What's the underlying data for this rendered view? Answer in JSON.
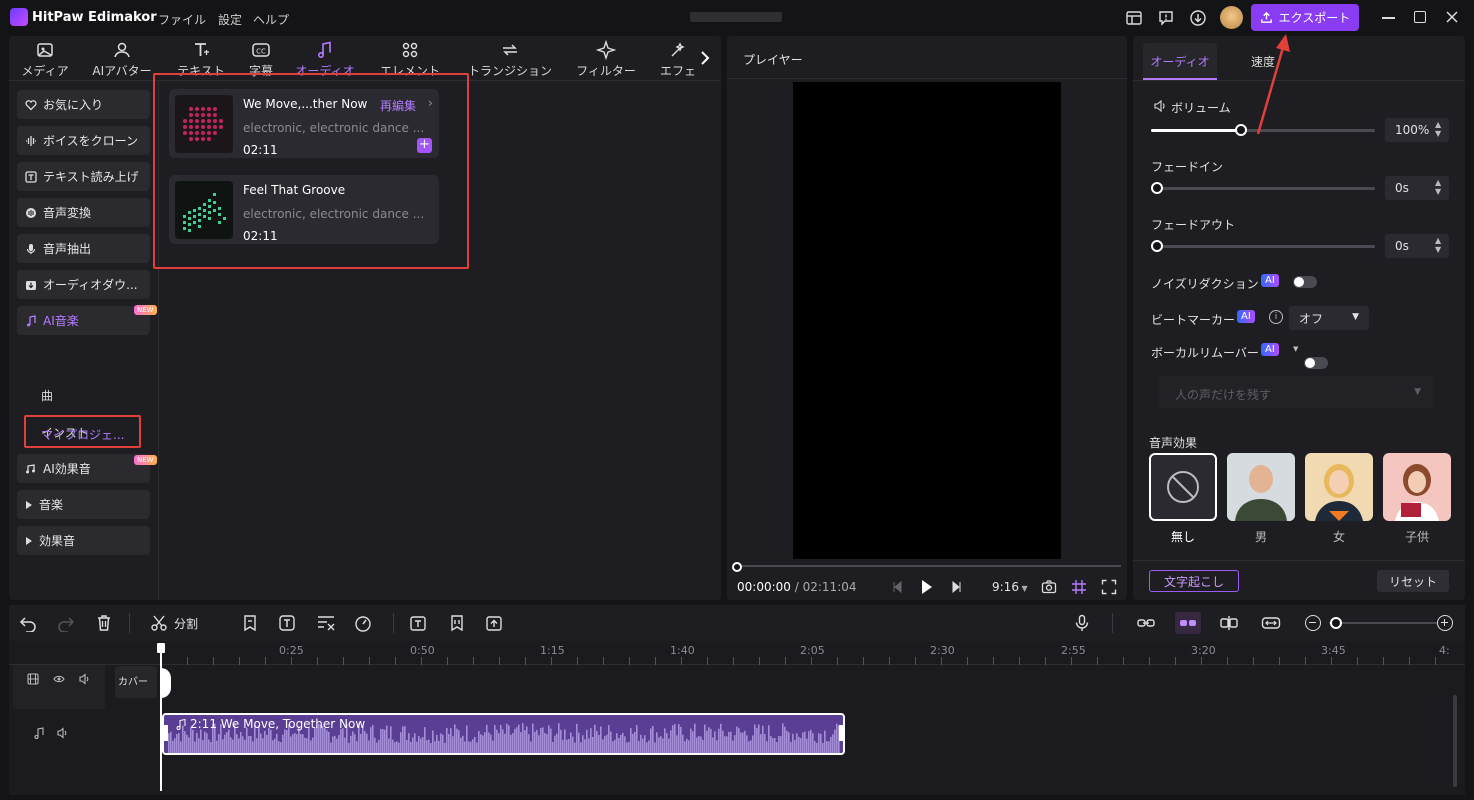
{
  "titlebar": {
    "app_name": "HitPaw Edimakor",
    "menu": [
      "ファイル",
      "設定",
      "ヘルプ"
    ],
    "export_label": "エクスポート"
  },
  "tabs": [
    "メディア",
    "AIアバター",
    "テキスト",
    "字幕",
    "オーディオ",
    "エレメント",
    "トランジション",
    "フィルター",
    "エフェ"
  ],
  "active_tab": "オーディオ",
  "categories": [
    {
      "label": "お気に入り"
    },
    {
      "label": "ボイスをクローン"
    },
    {
      "label": "テキスト読み上げ"
    },
    {
      "label": "音声変換"
    },
    {
      "label": "音声抽出"
    },
    {
      "label": "オーディオダウ..."
    },
    {
      "label": "AI音楽",
      "badge": "NEW"
    },
    {
      "label": "AI効果音",
      "badge": "NEW"
    },
    {
      "label": "音楽"
    },
    {
      "label": "効果音"
    }
  ],
  "ai_music_sub": [
    "曲",
    "インスト",
    "マイプロジェ..."
  ],
  "tracks": [
    {
      "title": "We Move,...ther Now",
      "action": "再編集",
      "tags": "electronic, electronic dance ...",
      "duration": "02:11"
    },
    {
      "title": "Feel That Groove",
      "tags": "electronic, electronic dance ...",
      "duration": "02:11"
    }
  ],
  "player": {
    "title": "プレイヤー",
    "current_time": "00:00:00",
    "separator": "/",
    "total_time": "02:11:04",
    "aspect": "9:16"
  },
  "right": {
    "tabs": [
      "オーディオ",
      "速度"
    ],
    "volume_label": "ボリューム",
    "volume_value": "100%",
    "volume_level": 0.4,
    "fadein_label": "フェードイン",
    "fadein_value": "0s",
    "fadeout_label": "フェードアウト",
    "fadeout_value": "0s",
    "noise_label": "ノイズリダクション",
    "beat_label": "ビートマーカー",
    "beat_value": "オフ",
    "vocal_label": "ボーカルリムーバー",
    "vocal_select": "人の声だけを残す",
    "ai_badge": "AI",
    "effects_label": "音声効果",
    "effects": [
      "無し",
      "男",
      "女",
      "子供"
    ],
    "transcribe_label": "文字起こし",
    "reset_label": "リセット"
  },
  "toolbar": {
    "split_label": "分割"
  },
  "timeline": {
    "ruler": [
      "0:25",
      "0:50",
      "1:15",
      "1:40",
      "2:05",
      "2:30",
      "2:55",
      "3:20",
      "3:45",
      "4:"
    ],
    "cover_label": "カバー",
    "clip_label": "2:11 We Move, Together Now"
  },
  "colors": {
    "accent": "#8a3cf2",
    "highlight_box": "#e0403a",
    "clip": "#a48ed8"
  }
}
